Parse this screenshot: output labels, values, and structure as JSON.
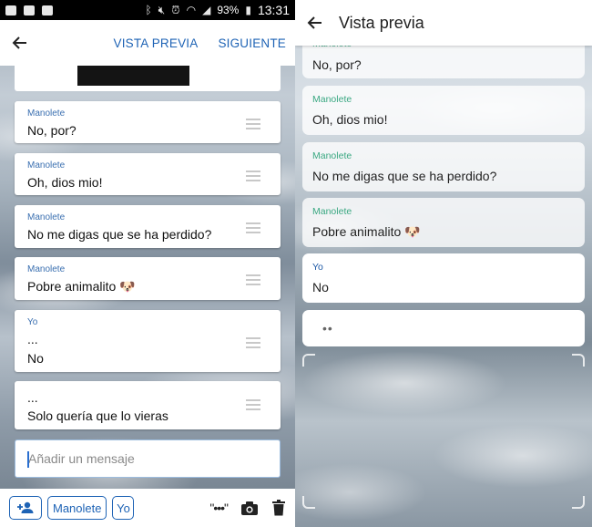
{
  "status_bar": {
    "battery": "93%",
    "time": "13:31"
  },
  "left_screen": {
    "toolbar": {
      "preview_label": "VISTA PREVIA",
      "next_label": "SIGUIENTE"
    },
    "messages": [
      {
        "sender": "Manolete",
        "text": "No, por?"
      },
      {
        "sender": "Manolete",
        "text": "Oh, dios mio!"
      },
      {
        "sender": "Manolete",
        "text": "No me digas que se ha perdido?"
      },
      {
        "sender": "Manolete",
        "text": "Pobre animalito 🐶"
      },
      {
        "sender": "Yo",
        "line1": "...",
        "line2": "No"
      },
      {
        "sender": "",
        "line1": "...",
        "line2": "Solo quería que lo vieras"
      }
    ],
    "compose": {
      "placeholder": "Añadir un mensaje"
    },
    "bottom_bar": {
      "sender_manolete": "Manolete",
      "sender_yo": "Yo",
      "typing_tool": "\"•••\""
    }
  },
  "right_screen": {
    "title": "Vista previa",
    "partial_sender": "Manolete",
    "messages": [
      {
        "sender": "",
        "text": "No, por?"
      },
      {
        "sender": "Manolete",
        "text": "Oh, dios mio!"
      },
      {
        "sender": "Manolete",
        "text": "No me digas que se ha perdido?"
      },
      {
        "sender": "Manolete",
        "text": "Pobre animalito 🐶"
      },
      {
        "sender": "Yo",
        "text": "No"
      }
    ],
    "typing_indicator": "••"
  },
  "colors": {
    "accent_blue": "#1e63b5",
    "sender_green": "#3aa882",
    "sender_blue": "#1f5aa6"
  }
}
